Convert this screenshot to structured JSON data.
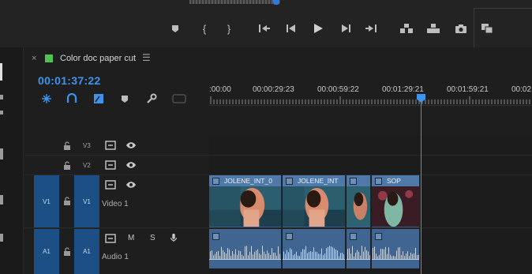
{
  "transport": {
    "buttons": [
      {
        "name": "add-marker-button",
        "icon": "marker-icon"
      },
      {
        "name": "mark-in-button",
        "icon": "mark-in-icon",
        "glyph": "{"
      },
      {
        "name": "mark-out-button",
        "icon": "mark-out-icon",
        "glyph": "}"
      },
      {
        "name": "go-to-in-button",
        "icon": "go-to-in-icon"
      },
      {
        "name": "step-back-button",
        "icon": "step-back-icon"
      },
      {
        "name": "play-button",
        "icon": "play-icon"
      },
      {
        "name": "step-forward-button",
        "icon": "step-forward-icon"
      },
      {
        "name": "go-to-out-button",
        "icon": "go-to-out-icon"
      },
      {
        "name": "insert-button",
        "icon": "insert-icon"
      },
      {
        "name": "overwrite-button",
        "icon": "overwrite-icon"
      },
      {
        "name": "export-frame-button",
        "icon": "camera-icon"
      },
      {
        "name": "comparison-view-button",
        "icon": "comparison-icon"
      }
    ]
  },
  "timeline": {
    "tab_title": "Color doc paper cut",
    "close_glyph": "×",
    "menu_glyph": "☰",
    "timecode": "00:01:37:22",
    "accent_color": "#3d94ee",
    "sequence_color": "#4fc24f",
    "ruler_labels": [
      ":00:00",
      "00:00:29:23",
      "00:00:59:22",
      "00:01:29:21",
      "00:01:59:21",
      "00:02"
    ],
    "tools": [
      "snap-icon",
      "linked-selection-icon",
      "add-marker-icon",
      "marker-icon",
      "wrench-icon",
      "caption-icon"
    ]
  },
  "tracks": {
    "video": [
      {
        "id": "V3",
        "label": "V3"
      },
      {
        "id": "V2",
        "label": "V2"
      },
      {
        "id": "V1",
        "label": "V1",
        "source": "V1",
        "name": "Video 1"
      }
    ],
    "audio": [
      {
        "id": "A1",
        "label": "A1",
        "source": "A1",
        "name": "Audio 1",
        "mute": "M",
        "solo": "S"
      }
    ]
  },
  "clips": {
    "video": [
      {
        "name": "JOLENE_INT_0"
      },
      {
        "name": "JOLENE_INT"
      },
      {
        "name": ""
      },
      {
        "name": "SOP"
      }
    ]
  }
}
